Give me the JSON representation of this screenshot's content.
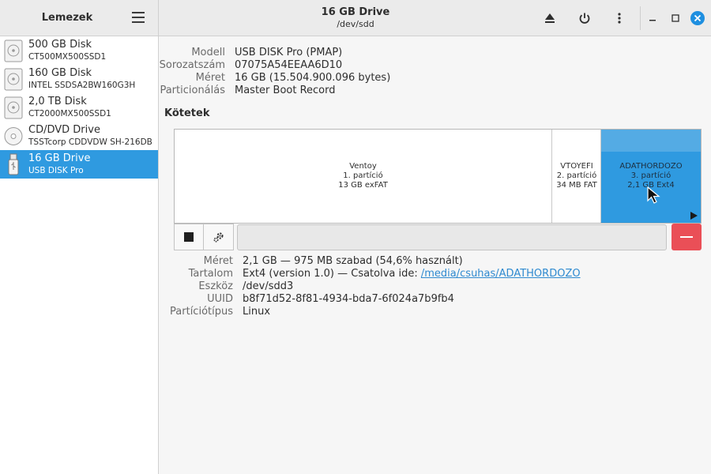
{
  "sidebar": {
    "title": "Lemezek",
    "menu_icon": "hamburger-menu-icon",
    "disks": [
      {
        "name": "500 GB Disk",
        "model": "CT500MX500SSD1",
        "icon": "hard-disk-icon"
      },
      {
        "name": "160 GB Disk",
        "model": "INTEL SSDSA2BW160G3H",
        "icon": "hard-disk-icon"
      },
      {
        "name": "2,0 TB Disk",
        "model": "CT2000MX500SSD1",
        "icon": "hard-disk-icon"
      },
      {
        "name": "CD/DVD Drive",
        "model": "TSSTcorp CDDVDW SH-216DB",
        "icon": "optical-disc-icon"
      },
      {
        "name": "16 GB Drive",
        "model": "USB DISK Pro",
        "icon": "usb-drive-icon",
        "selected": true
      }
    ]
  },
  "header": {
    "title": "16 GB Drive",
    "subtitle": "/dev/sdd",
    "accent": "#2f9ae0"
  },
  "drive_info": {
    "model_label": "Modell",
    "model_value": "USB DISK Pro (PMAP)",
    "serial_label": "Sorozatszám",
    "serial_value": "07075A54EEAA6D10",
    "size_label": "Méret",
    "size_value": "16 GB (15.504.900.096 bytes)",
    "partitioning_label": "Particionálás",
    "partitioning_value": "Master Boot Record"
  },
  "volumes": {
    "title": "Kötetek",
    "partitions": [
      {
        "name": "Ventoy",
        "index": "1. partíció",
        "size": "13 GB exFAT"
      },
      {
        "name": "VTOYEFI",
        "index": "2. partíció",
        "size": "34 MB FAT"
      },
      {
        "name": "ADATHORDOZO",
        "index": "3. partíció",
        "size": "2,1 GB Ext4",
        "selected": true
      }
    ]
  },
  "volume_info": {
    "size_label": "Méret",
    "size_value": "2,1 GB — 975 MB szabad (54,6% használt)",
    "content_label": "Tartalom",
    "content_prefix": "Ext4 (version 1.0) — Csatolva ide:",
    "content_link": "/media/csuhas/ADATHORDOZO",
    "device_label": "Eszköz",
    "device_value": "/dev/sdd3",
    "uuid_label": "UUID",
    "uuid_value": "b8f71d52-8f81-4934-bda7-6f024a7b9fb4",
    "parttype_label": "Partíciótípus",
    "parttype_value": "Linux"
  },
  "colors": {
    "selection": "#2f9ae0",
    "delete": "#ea4f57",
    "close": "#1e8fe0"
  }
}
